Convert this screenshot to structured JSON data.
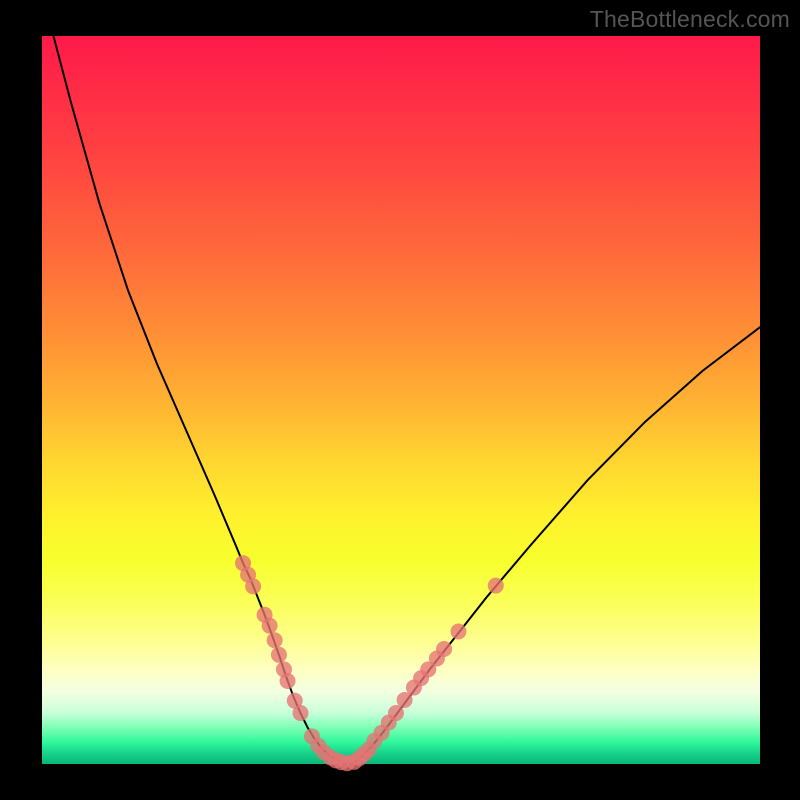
{
  "watermark": "TheBottleneck.com",
  "colors": {
    "background": "#000000",
    "curve_stroke": "#000000",
    "marker_fill": "#e57373",
    "gradient_top": "#ff1a49",
    "gradient_bottom": "#09b677"
  },
  "chart_data": {
    "type": "line",
    "title": "",
    "xlabel": "",
    "ylabel": "",
    "xlim": [
      0,
      100
    ],
    "ylim": [
      0,
      100
    ],
    "grid": false,
    "legend": false,
    "annotations": [
      "TheBottleneck.com"
    ],
    "series": [
      {
        "name": "bottleneck-curve",
        "x": [
          1.6,
          4,
          8,
          12,
          16,
          20,
          24,
          27,
          28,
          29,
          30,
          31,
          32,
          33,
          34,
          35,
          36,
          37,
          38,
          39,
          40,
          41.3,
          42,
          43.2,
          44,
          46,
          48,
          51,
          54,
          58,
          62,
          68,
          76,
          84,
          92,
          100
        ],
        "values": [
          100,
          91,
          77,
          65,
          55,
          46,
          37,
          30,
          27.6,
          25.5,
          23,
          20.5,
          17.8,
          15,
          12,
          9.3,
          7,
          5,
          3.4,
          2.1,
          1.2,
          0.5,
          0.1,
          0.1,
          0.5,
          2.5,
          5,
          9,
          13,
          18,
          23,
          30,
          39,
          47,
          54,
          60
        ]
      }
    ],
    "markers": [
      {
        "x": 28.0,
        "y": 27.6
      },
      {
        "x": 28.7,
        "y": 26.0
      },
      {
        "x": 29.4,
        "y": 24.4
      },
      {
        "x": 31.0,
        "y": 20.5
      },
      {
        "x": 31.7,
        "y": 19.0
      },
      {
        "x": 32.4,
        "y": 17.0
      },
      {
        "x": 33.0,
        "y": 15.0
      },
      {
        "x": 33.7,
        "y": 13.0
      },
      {
        "x": 34.2,
        "y": 11.4
      },
      {
        "x": 35.2,
        "y": 8.7
      },
      {
        "x": 36.0,
        "y": 7.0
      },
      {
        "x": 37.6,
        "y": 3.8
      },
      {
        "x": 38.5,
        "y": 2.5
      },
      {
        "x": 39.3,
        "y": 1.6
      },
      {
        "x": 40.2,
        "y": 0.9
      },
      {
        "x": 40.9,
        "y": 0.5
      },
      {
        "x": 41.7,
        "y": 0.25
      },
      {
        "x": 42.5,
        "y": 0.1
      },
      {
        "x": 43.5,
        "y": 0.3
      },
      {
        "x": 44.2,
        "y": 0.8
      },
      {
        "x": 44.9,
        "y": 1.4
      },
      {
        "x": 45.5,
        "y": 2.0
      },
      {
        "x": 46.3,
        "y": 3.2
      },
      {
        "x": 47.3,
        "y": 4.3
      },
      {
        "x": 48.3,
        "y": 5.7
      },
      {
        "x": 49.3,
        "y": 7.0
      },
      {
        "x": 50.5,
        "y": 8.8
      },
      {
        "x": 51.8,
        "y": 10.5
      },
      {
        "x": 52.8,
        "y": 11.8
      },
      {
        "x": 53.8,
        "y": 13.0
      },
      {
        "x": 55.0,
        "y": 14.5
      },
      {
        "x": 56.0,
        "y": 15.8
      },
      {
        "x": 58.0,
        "y": 18.2
      },
      {
        "x": 63.2,
        "y": 24.5
      }
    ]
  }
}
